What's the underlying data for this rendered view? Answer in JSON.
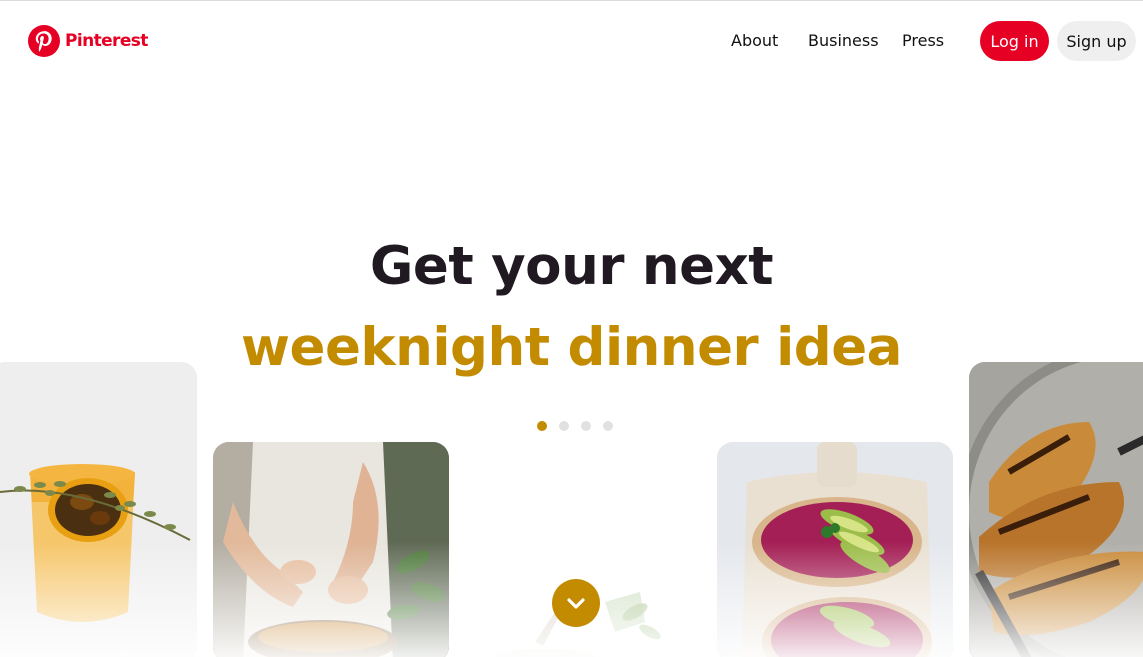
{
  "header": {
    "brand_name": "Pinterest",
    "nav": {
      "about": "About",
      "business": "Business",
      "press": "Press"
    },
    "login_label": "Log in",
    "signup_label": "Sign up"
  },
  "hero": {
    "headline_line1": "Get your next",
    "headline_line2": "weeknight dinner idea",
    "carousel_dot_count": 4,
    "carousel_active_index": 0
  },
  "cards": [
    {
      "icon": "orange-drink-with-thyme"
    },
    {
      "icon": "person-garnishing-dish"
    },
    {
      "icon": "bowl-with-greens"
    },
    {
      "icon": "beet-hummus-avocado-toast"
    },
    {
      "icon": "grilled-chicken-plate"
    }
  ],
  "colors": {
    "brand_red": "#e60023",
    "accent_gold": "#c28b00",
    "headline_dark": "#211922",
    "signup_bg": "#efefef"
  }
}
